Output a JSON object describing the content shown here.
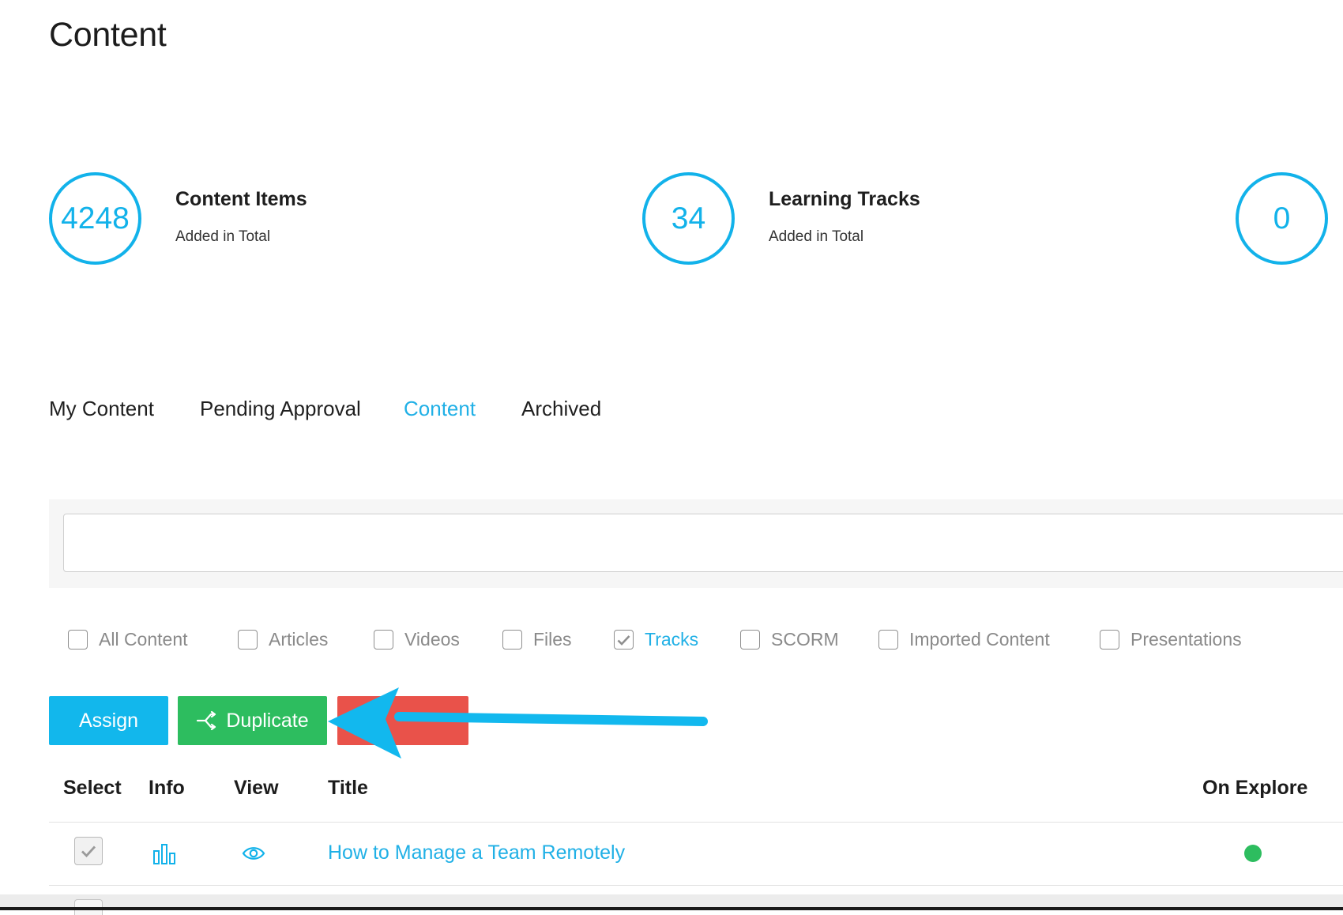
{
  "page": {
    "title": "Content"
  },
  "stats": [
    {
      "value": "4248",
      "label": "Content Items",
      "sub": "Added in Total"
    },
    {
      "value": "34",
      "label": "Learning Tracks",
      "sub": "Added in Total"
    },
    {
      "value": "0"
    }
  ],
  "tabs": [
    {
      "label": "My Content",
      "active": false
    },
    {
      "label": "Pending Approval",
      "active": false
    },
    {
      "label": "Content",
      "active": true
    },
    {
      "label": "Archived",
      "active": false
    }
  ],
  "search": {
    "value": "",
    "placeholder": ""
  },
  "filters": [
    {
      "label": "All Content",
      "checked": false
    },
    {
      "label": "Articles",
      "checked": false
    },
    {
      "label": "Videos",
      "checked": false
    },
    {
      "label": "Files",
      "checked": false
    },
    {
      "label": "Tracks",
      "checked": true
    },
    {
      "label": "SCORM",
      "checked": false
    },
    {
      "label": "Imported Content",
      "checked": false
    },
    {
      "label": "Presentations",
      "checked": false
    }
  ],
  "actions": {
    "assign": "Assign",
    "duplicate": "Duplicate",
    "delete": ""
  },
  "table": {
    "headers": {
      "select": "Select",
      "info": "Info",
      "view": "View",
      "title": "Title",
      "on_explore": "On Explore"
    },
    "rows": [
      {
        "selected": true,
        "title": "How to Manage a Team Remotely",
        "on_explore": true
      }
    ]
  },
  "colors": {
    "accent": "#12b2ea",
    "success": "#2dbd5f",
    "danger": "#e9524a",
    "annotation_arrow": "#12b8ee"
  },
  "icons": {
    "info": "bar-chart-icon",
    "view": "eye-icon",
    "duplicate": "duplicate-icon",
    "check": "checkmark-icon"
  }
}
